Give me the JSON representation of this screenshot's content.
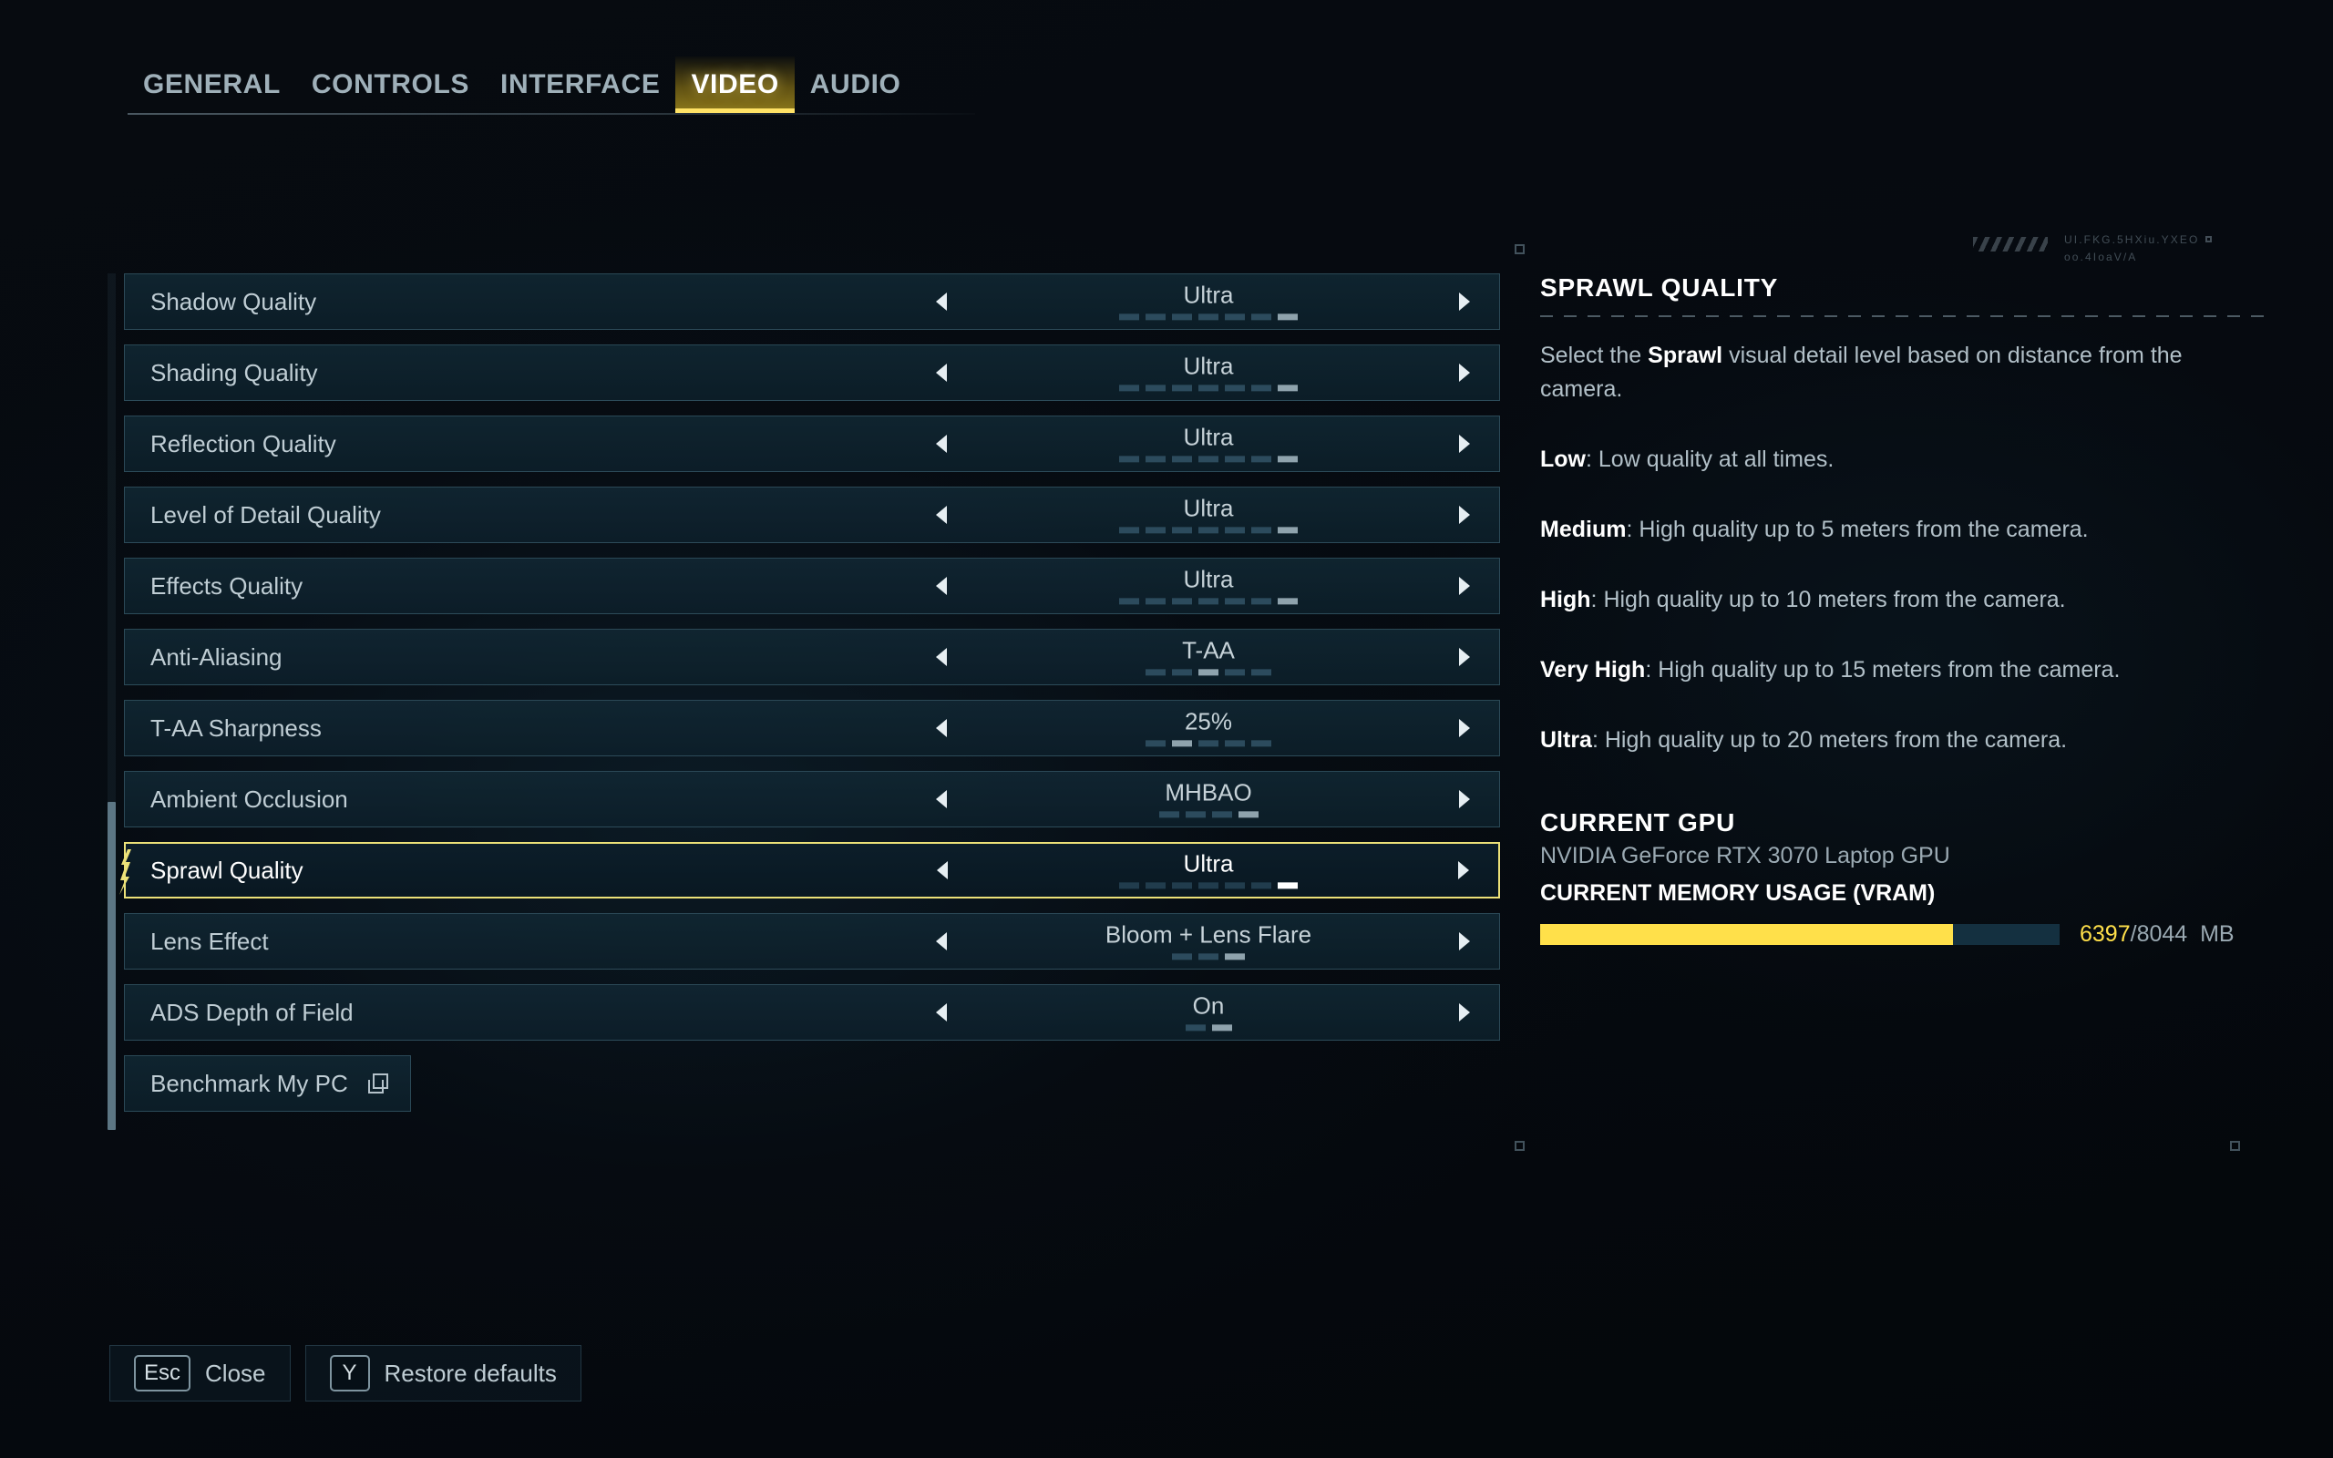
{
  "tabs": [
    {
      "label": "GENERAL",
      "active": false
    },
    {
      "label": "CONTROLS",
      "active": false
    },
    {
      "label": "INTERFACE",
      "active": false
    },
    {
      "label": "VIDEO",
      "active": true
    },
    {
      "label": "AUDIO",
      "active": false
    }
  ],
  "settings": [
    {
      "label": "Shadow Quality",
      "value": "Ultra",
      "ticks": 7,
      "active_tick": 7,
      "selected": false
    },
    {
      "label": "Shading Quality",
      "value": "Ultra",
      "ticks": 7,
      "active_tick": 7,
      "selected": false
    },
    {
      "label": "Reflection Quality",
      "value": "Ultra",
      "ticks": 7,
      "active_tick": 7,
      "selected": false
    },
    {
      "label": "Level of Detail Quality",
      "value": "Ultra",
      "ticks": 7,
      "active_tick": 7,
      "selected": false
    },
    {
      "label": "Effects Quality",
      "value": "Ultra",
      "ticks": 7,
      "active_tick": 7,
      "selected": false
    },
    {
      "label": "Anti-Aliasing",
      "value": "T-AA",
      "ticks": 5,
      "active_tick": 3,
      "selected": false
    },
    {
      "label": "T-AA Sharpness",
      "value": "25%",
      "ticks": 5,
      "active_tick": 2,
      "selected": false
    },
    {
      "label": "Ambient Occlusion",
      "value": "MHBAO",
      "ticks": 4,
      "active_tick": 4,
      "selected": false
    },
    {
      "label": "Sprawl Quality",
      "value": "Ultra",
      "ticks": 7,
      "active_tick": 7,
      "selected": true
    },
    {
      "label": "Lens Effect",
      "value": "Bloom + Lens Flare",
      "ticks": 3,
      "active_tick": 3,
      "selected": false
    },
    {
      "label": "ADS Depth of Field",
      "value": "On",
      "ticks": 2,
      "active_tick": 2,
      "selected": false
    }
  ],
  "benchmark": {
    "label": "Benchmark My PC"
  },
  "info": {
    "title": "SPRAWL QUALITY",
    "intro_before": "Select the ",
    "intro_bold": "Sprawl",
    "intro_after": " visual detail level based on distance from the camera.",
    "levels": [
      {
        "name": "Low",
        "text": ": Low quality at all times."
      },
      {
        "name": "Medium",
        "text": ": High quality up to 5 meters from the camera."
      },
      {
        "name": "High",
        "text": ": High quality up to 10 meters from the camera."
      },
      {
        "name": "Very High",
        "text": ": High quality up to 15 meters from the camera."
      },
      {
        "name": "Ultra",
        "text": ": High quality up to 20 meters from the camera."
      }
    ],
    "techmark_line1": "UI.FKG.5HXiu.YXEO",
    "techmark_line2": "oo.4IoaV/A"
  },
  "gpu": {
    "title": "CURRENT GPU",
    "name": "NVIDIA GeForce RTX 3070 Laptop GPU",
    "vram_title": "CURRENT MEMORY USAGE (VRAM)",
    "vram_used": "6397",
    "vram_sep": "/",
    "vram_total": "8044",
    "vram_unit": "MB",
    "vram_percent": 79.5
  },
  "footer": [
    {
      "key": "Esc",
      "label": "Close"
    },
    {
      "key": "Y",
      "label": "Restore defaults"
    }
  ],
  "colors": {
    "accent": "#ffe04a",
    "selected_border": "#ece178",
    "panel_bg": "#0e2432"
  }
}
